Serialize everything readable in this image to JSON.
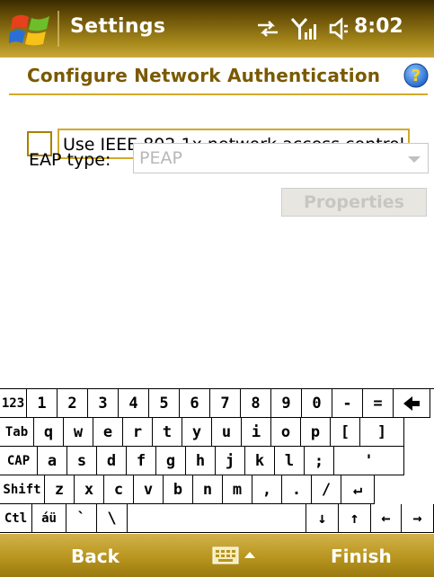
{
  "titlebar": {
    "title": "Settings",
    "time": "8:02",
    "icons": [
      "windows-start-icon",
      "sync-arrows-icon",
      "signal-strength-icon",
      "speaker-icon"
    ]
  },
  "header": {
    "title": "Configure Network Authentication",
    "help_icon": "help-icon"
  },
  "form": {
    "checkbox_label": "Use IEEE 802.1x network access control",
    "checkbox_checked": false,
    "eap_label": "EAP type:",
    "eap_value": "PEAP",
    "eap_disabled": true,
    "properties_label": "Properties",
    "properties_disabled": true
  },
  "keyboard": {
    "rows": [
      [
        "123",
        "1",
        "2",
        "3",
        "4",
        "5",
        "6",
        "7",
        "8",
        "9",
        "0",
        "-",
        "=",
        "◆"
      ],
      [
        "Tab",
        "q",
        "w",
        "e",
        "r",
        "t",
        "y",
        "u",
        "i",
        "o",
        "p",
        "[",
        "]"
      ],
      [
        "CAP",
        "a",
        "s",
        "d",
        "f",
        "g",
        "h",
        "j",
        "k",
        "l",
        ";",
        "'"
      ],
      [
        "Shift",
        "z",
        "x",
        "c",
        "v",
        "b",
        "n",
        "m",
        ",",
        ".",
        "/",
        "↵"
      ],
      [
        "Ctl",
        "áü",
        "`",
        "\\",
        "",
        "↓",
        "↑",
        "←",
        "→"
      ]
    ]
  },
  "menubar": {
    "left": "Back",
    "right": "Finish",
    "center_icon": "keyboard-icon"
  },
  "colors": {
    "accent": "#d3a92a",
    "header_text": "#7a5a00",
    "bar_gold": "#b8951e"
  }
}
